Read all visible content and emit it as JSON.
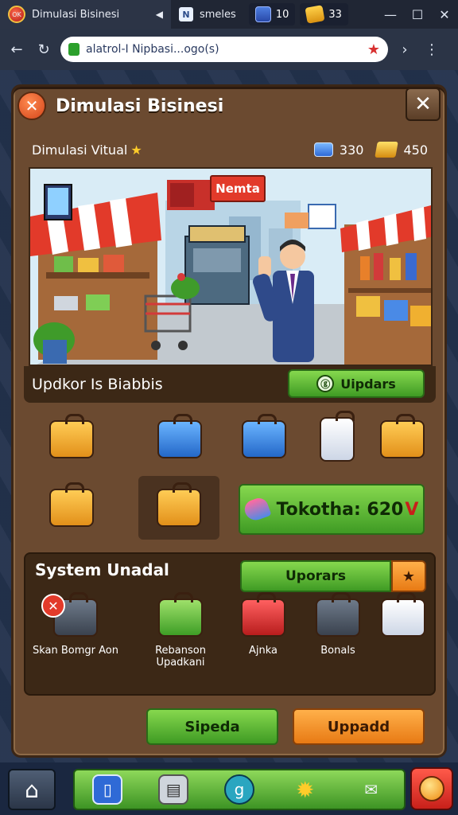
{
  "browser": {
    "active_tab_title": "Dimulasi Bisinesi",
    "second_tab_title": "smeles",
    "currency_blue": "10",
    "currency_gold": "33",
    "url_text": "alatrol-I Nipbasi...ogo(s)",
    "favicon_text": "OK"
  },
  "window_controls": {
    "minimize": "—",
    "maximize": "☐",
    "close": "✕"
  },
  "panel": {
    "title": "Dimulasi Bisinesi",
    "close_symbol": "✕",
    "subtitle": "Dimulasi Vitual",
    "gem_count": "330",
    "gold_count": "450",
    "scene_sign": "Nemta"
  },
  "update_banner": {
    "label": "Updkor Is Biabbis",
    "button_label": "Uipdars",
    "button_icon": "ⓖ"
  },
  "items": [
    {
      "icon": "orange-box-icon"
    },
    {
      "icon": "blue-case-icon"
    },
    {
      "icon": "blue-box-icon"
    },
    {
      "icon": "phone-icon"
    },
    {
      "icon": "camera-box-icon"
    },
    {
      "icon": "orange-case-icon"
    },
    {
      "icon": "open-box-icon"
    }
  ],
  "total": {
    "label": "Tokotha: 620",
    "suffix": "V"
  },
  "system": {
    "title": "System Unadal",
    "button_label": "Uporars",
    "items": [
      {
        "label": "Skan Bomgr Aon",
        "icon": "machine-icon"
      },
      {
        "label": "Rebanson Upadkani",
        "icon": "green-box-icon"
      },
      {
        "label": "Ajnka",
        "icon": "red-box-icon"
      },
      {
        "label": "Bonals",
        "icon": "dark-case-icon"
      },
      {
        "label": "",
        "icon": "card-icon"
      }
    ]
  },
  "actions": {
    "left_label": "Sipeda",
    "right_label": "Uppadd"
  },
  "colors": {
    "panel": "#6b4a30",
    "green": "#4fa82a",
    "orange": "#f08a1c",
    "red": "#e23a2a",
    "background": "#23324d"
  }
}
